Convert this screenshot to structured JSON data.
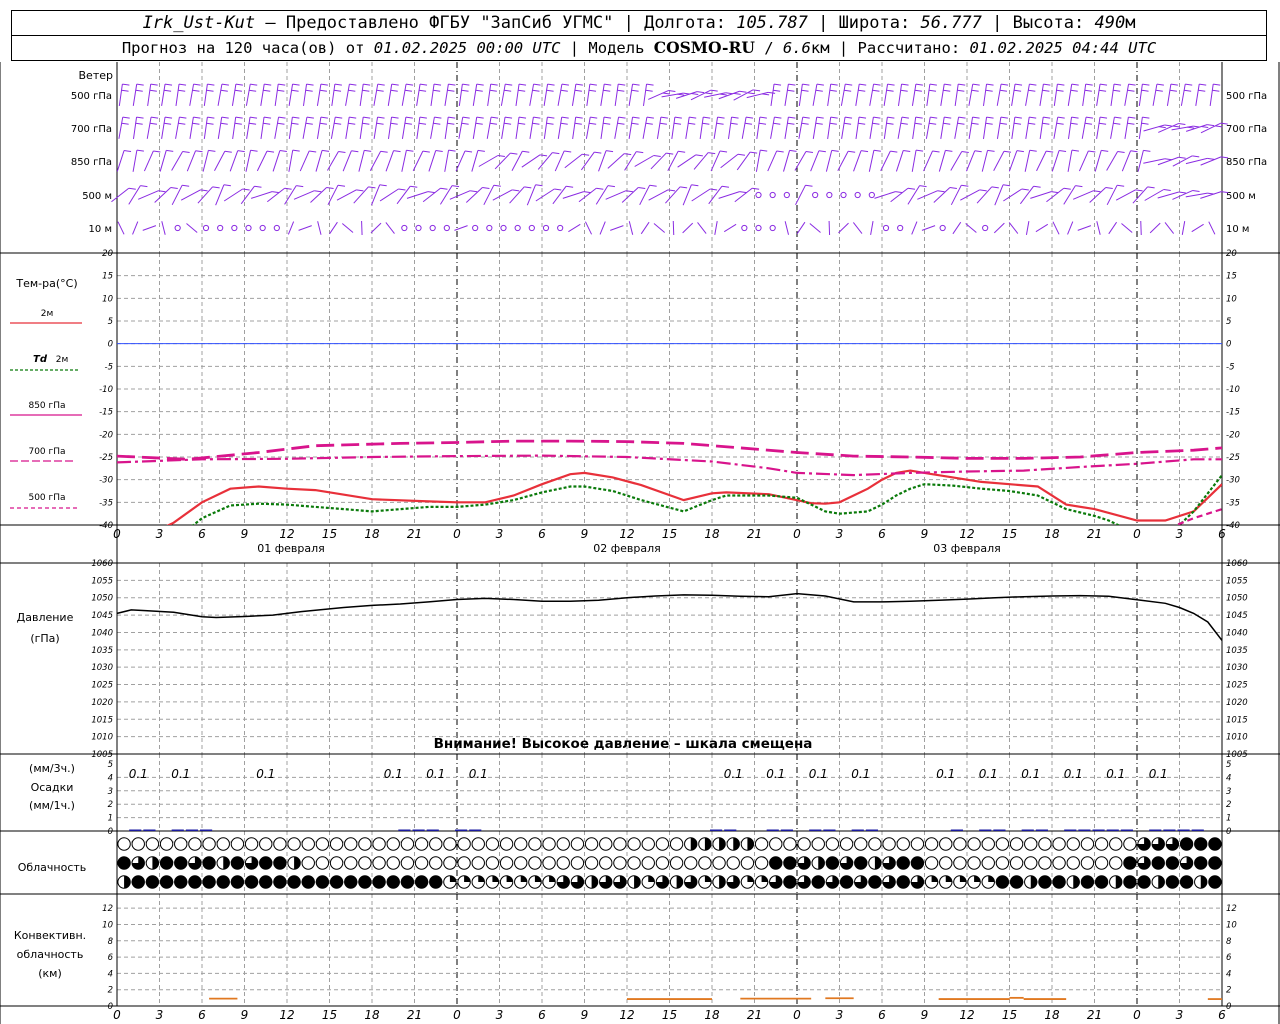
{
  "header": {
    "station": "Irk_Ust-Kut",
    "provider": " – Предоставлено ФГБУ \"ЗапСиб УГМС\" | Долгота: ",
    "lon": "105.787",
    "lat_label": " | Широта: ",
    "lat": "56.777",
    "alt_label": " | Высота: ",
    "alt": "490",
    "alt_unit": "м",
    "forecast_label": "Прогноз на 120 часа(ов) от ",
    "forecast_time": "01.02.2025 00:00 UTC",
    "model_label": " | Модель ",
    "model_name": "COSMO-RU",
    "model_sep": " / ",
    "model_res": "6.6",
    "model_unit": "км",
    "calc_label": " | Рассчитано: ",
    "calc_time": "01.02.2025 04:44 UTC"
  },
  "colors": {
    "wind": "#8a2be2",
    "t2m": "#e8303a",
    "td2m": "#0a7a0a",
    "t850": "#d8148c",
    "t700": "#d8148c",
    "t500": "#d8148c",
    "pressure": "#000000",
    "zero_line": "#3050ff",
    "precip": "#1a1aa0",
    "conv": "#e07820",
    "grid": "#a0a0a0"
  },
  "labels": {
    "wind": "Ветер",
    "wind_levels": [
      "500 гПа",
      "700 гПа",
      "850 гПа",
      "500 м",
      "10  м"
    ],
    "wind_levels_right": [
      "500 гПа",
      "700 гПа",
      "850 гПа",
      "500 м",
      "10  м"
    ],
    "temp": "Тем-ра(°C)",
    "leg_t2m": "2м",
    "leg_td_sym": "Td",
    "leg_td": "2м",
    "leg_850": "850 гПа",
    "leg_700": "700 гПа",
    "leg_500": "500 гПа",
    "pressure1": "Давление",
    "pressure2": "(гПа)",
    "warning": "Внимание! Высокое давление – шкала смещена",
    "precip1": "(мм/3ч.)",
    "precip2": "Осадки",
    "precip3": "(мм/1ч.)",
    "cloud": "Облачность",
    "conv1": "Конвективн.",
    "conv2": "облачность",
    "conv3": "(км)",
    "day1": "01 февраля",
    "day2": "02 февраля",
    "day3": "03 февраля"
  },
  "chart_data": [
    {
      "type": "line",
      "panel": "temperature",
      "x_hours": [
        0,
        3,
        6,
        9,
        12,
        15,
        18,
        21,
        24,
        27,
        30,
        33,
        36,
        39,
        42,
        45,
        48,
        51,
        54,
        57,
        60,
        63,
        66,
        69,
        72,
        75,
        78
      ],
      "x_tick_labels": [
        "0",
        "3",
        "6",
        "9",
        "12",
        "15",
        "18",
        "21",
        "0",
        "3",
        "6",
        "9",
        "12",
        "15",
        "18",
        "21",
        "0",
        "3",
        "6",
        "9",
        "12",
        "15",
        "18",
        "21",
        "0",
        "3",
        "6"
      ],
      "ylim": [
        -40,
        20
      ],
      "y_ticks": [
        20,
        15,
        10,
        5,
        0,
        -5,
        -10,
        -15,
        -20,
        -25,
        -30,
        -35,
        -40
      ],
      "series": [
        {
          "name": "2м",
          "key": "t2m",
          "x": [
            0,
            3,
            4,
            6,
            8,
            10,
            12,
            14,
            18,
            22,
            24,
            26,
            28,
            30,
            32,
            33,
            35,
            37,
            40,
            42,
            43,
            46,
            49,
            50,
            51,
            53,
            54,
            55,
            56,
            57,
            59,
            61,
            63,
            65,
            67,
            69,
            72,
            74,
            76,
            78
          ],
          "y": [
            -44,
            -41,
            -39.5,
            -35,
            -32,
            -31.5,
            -32,
            -32.3,
            -34.3,
            -34.8,
            -35,
            -35,
            -33.5,
            -31,
            -28.8,
            -28.5,
            -29.5,
            -31.2,
            -34.5,
            -33,
            -32.8,
            -33.2,
            -35.2,
            -35.3,
            -35,
            -32,
            -30,
            -28.5,
            -28,
            -28.5,
            -29.5,
            -30.5,
            -31,
            -31.5,
            -35.5,
            -36.5,
            -39,
            -39,
            -37,
            -31
          ]
        },
        {
          "name": "Td 2м",
          "key": "td2m",
          "x": [
            0,
            4,
            5,
            6,
            8,
            10,
            12,
            14,
            16,
            18,
            22,
            24,
            26,
            28,
            30,
            32,
            33,
            35,
            37,
            40,
            42,
            43,
            46,
            48,
            49,
            50,
            51,
            53,
            54,
            55,
            56,
            57,
            59,
            61,
            63,
            65,
            67,
            69,
            70,
            71,
            72,
            74,
            75,
            76,
            78
          ],
          "y": [
            -46,
            -43,
            -41,
            -38.5,
            -35.7,
            -35.3,
            -35.5,
            -36,
            -36.5,
            -37,
            -36,
            -36,
            -35.5,
            -34.5,
            -32.8,
            -31.5,
            -31.5,
            -32.5,
            -34.5,
            -37,
            -34.5,
            -33.5,
            -33.5,
            -34,
            -35.5,
            -37,
            -37.5,
            -37,
            -35.5,
            -33.5,
            -32,
            -31,
            -31.3,
            -32,
            -32.5,
            -33.5,
            -36.5,
            -38,
            -39,
            -40.5,
            -42,
            -42,
            -40,
            -37,
            -29
          ]
        },
        {
          "name": "850 гПа",
          "key": "t850",
          "x": [
            0,
            5,
            10,
            14,
            20,
            24,
            28,
            32,
            36,
            40,
            44,
            48,
            52,
            56,
            60,
            64,
            68,
            72,
            76,
            78
          ],
          "y": [
            -24.8,
            -25.5,
            -24,
            -22.5,
            -22,
            -21.8,
            -21.5,
            -21.5,
            -21.6,
            -22,
            -23,
            -24,
            -24.8,
            -25,
            -25.3,
            -25.3,
            -25,
            -24,
            -23.5,
            -23
          ]
        },
        {
          "name": "700 гПа",
          "key": "t700",
          "x": [
            0,
            6,
            12,
            18,
            24,
            30,
            36,
            42,
            46,
            48,
            52,
            56,
            60,
            64,
            68,
            72,
            76,
            78
          ],
          "y": [
            -26.2,
            -25.5,
            -25.4,
            -25,
            -24.8,
            -24.7,
            -25,
            -26,
            -27.5,
            -28.5,
            -29,
            -28.5,
            -28.2,
            -28,
            -27.2,
            -26.5,
            -25.5,
            -25.5
          ]
        },
        {
          "name": "500 гПа",
          "key": "t500",
          "x": [
            0,
            72,
            74,
            76,
            78
          ],
          "y": [
            -46,
            -46,
            -41,
            -38.5,
            -36.5
          ]
        }
      ]
    },
    {
      "type": "line",
      "panel": "pressure",
      "x_hours": [
        0,
        3,
        6,
        9,
        12,
        15,
        18,
        21,
        24,
        27,
        30,
        33,
        36,
        39,
        42,
        45,
        48,
        51,
        54,
        57,
        60,
        63,
        66,
        69,
        72,
        75,
        78
      ],
      "ylim": [
        1005,
        1060
      ],
      "y_ticks": [
        1060,
        1055,
        1050,
        1045,
        1040,
        1035,
        1030,
        1025,
        1020,
        1015,
        1010,
        1005
      ],
      "series": [
        {
          "name": "Давление",
          "key": "pressure",
          "x": [
            0,
            1,
            2,
            4,
            6,
            7,
            9,
            11,
            13,
            16,
            18,
            20,
            22,
            24,
            26,
            28,
            30,
            32,
            34,
            36,
            38,
            40,
            42,
            44,
            46,
            48,
            50,
            52,
            54,
            56,
            58,
            60,
            62,
            64,
            66,
            68,
            70,
            72,
            74,
            75,
            76,
            77,
            78
          ],
          "y": [
            1045.5,
            1046.5,
            1046.3,
            1045.8,
            1044.5,
            1044.3,
            1044.6,
            1045,
            1046,
            1047.2,
            1047.8,
            1048.2,
            1048.8,
            1049.5,
            1049.8,
            1049.5,
            1049,
            1049,
            1049.3,
            1050,
            1050.5,
            1050.8,
            1050.7,
            1050.4,
            1050.3,
            1051.2,
            1050.5,
            1048.8,
            1048.8,
            1049,
            1049.3,
            1049.6,
            1050,
            1050.3,
            1050.5,
            1050.6,
            1050.4,
            1049.4,
            1048.4,
            1047.2,
            1045.5,
            1043,
            1037.7
          ]
        }
      ]
    },
    {
      "type": "bar",
      "panel": "precipitation",
      "ylim": [
        0,
        5
      ],
      "y_ticks": [
        "5",
        "4",
        "3",
        "2",
        "1",
        "0"
      ],
      "labels_3h": [
        {
          "x": 1.5,
          "text": "0.1"
        },
        {
          "x": 4.5,
          "text": "0.1"
        },
        {
          "x": 10.5,
          "text": "0.1"
        },
        {
          "x": 19.5,
          "text": "0.1"
        },
        {
          "x": 22.5,
          "text": "0.1"
        },
        {
          "x": 25.5,
          "text": "0.1"
        },
        {
          "x": 43.5,
          "text": "0.1"
        },
        {
          "x": 46.5,
          "text": "0.1"
        },
        {
          "x": 49.5,
          "text": "0.1"
        },
        {
          "x": 52.5,
          "text": "0.1"
        },
        {
          "x": 58.5,
          "text": "0.1"
        },
        {
          "x": 61.5,
          "text": "0.1"
        },
        {
          "x": 64.5,
          "text": "0.1"
        },
        {
          "x": 67.5,
          "text": "0.1"
        },
        {
          "x": 70.5,
          "text": "0.1"
        },
        {
          "x": 73.5,
          "text": "0.1"
        }
      ],
      "hourly_marks_hours": [
        1,
        2,
        4,
        5,
        6,
        20,
        21,
        22,
        24,
        25,
        42,
        43,
        46,
        47,
        49,
        50,
        52,
        53,
        59,
        61,
        62,
        64,
        65,
        67,
        68,
        69,
        70,
        71,
        73,
        74,
        75,
        76
      ]
    },
    {
      "type": "bar",
      "panel": "convective_cloud",
      "ylim": [
        0,
        13
      ],
      "y_ticks": [
        "12",
        "10",
        "8",
        "6",
        "4",
        "2",
        "0"
      ],
      "segments": [
        {
          "x0": 6.5,
          "x1": 8.5,
          "top": 0.9
        },
        {
          "x0": 36,
          "x1": 42,
          "top": 0.85
        },
        {
          "x0": 44,
          "x1": 49,
          "top": 0.9
        },
        {
          "x0": 50,
          "x1": 52,
          "top": 0.95
        },
        {
          "x0": 58,
          "x1": 63,
          "top": 0.85
        },
        {
          "x0": 63,
          "x1": 64,
          "top": 1.0
        },
        {
          "x0": 64,
          "x1": 67,
          "top": 0.85
        },
        {
          "x0": 77,
          "x1": 78,
          "top": 0.85
        }
      ]
    }
  ]
}
